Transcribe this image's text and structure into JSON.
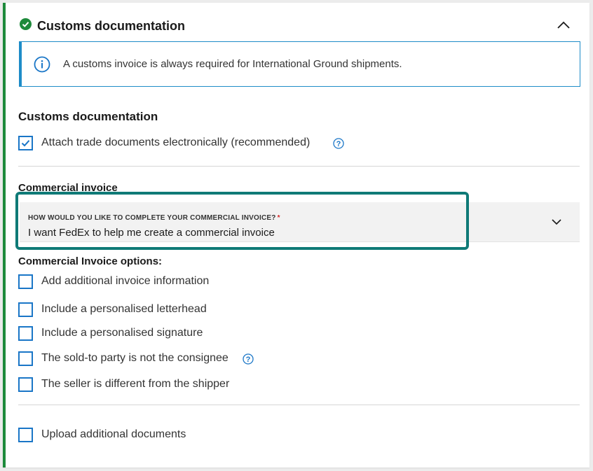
{
  "section": {
    "header_title": "Customs documentation",
    "info_text": "A customs invoice is always required for International Ground shipments.",
    "subsection_title": "Customs documentation",
    "attach_label": "Attach trade documents electronically (recommended)"
  },
  "commercial_invoice": {
    "title": "Commercial invoice",
    "dropdown_label": "HOW WOULD YOU LIKE TO COMPLETE YOUR COMMERCIAL INVOICE?",
    "dropdown_required_mark": "*",
    "dropdown_value": "I want FedEx to help me create a commercial invoice"
  },
  "options": {
    "title": "Commercial Invoice options:",
    "items": [
      {
        "label": "Add additional invoice information",
        "checked": false
      },
      {
        "label": "Include a personalised letterhead",
        "checked": false
      },
      {
        "label": "Include a personalised signature",
        "checked": false
      },
      {
        "label": "The sold-to party is not the consignee",
        "checked": false
      },
      {
        "label": "The seller is different from the shipper",
        "checked": false
      }
    ],
    "upload_label": "Upload additional documents"
  },
  "colors": {
    "accent_green": "#1e8a3b",
    "info_blue": "#1e8cc8",
    "checkbox_blue": "#1a76c7",
    "highlight_teal": "#0f7a77"
  },
  "icons": [
    "check-circle-icon",
    "chevron-up-icon",
    "info-icon",
    "checkmark-icon",
    "help-icon",
    "chevron-down-icon"
  ]
}
